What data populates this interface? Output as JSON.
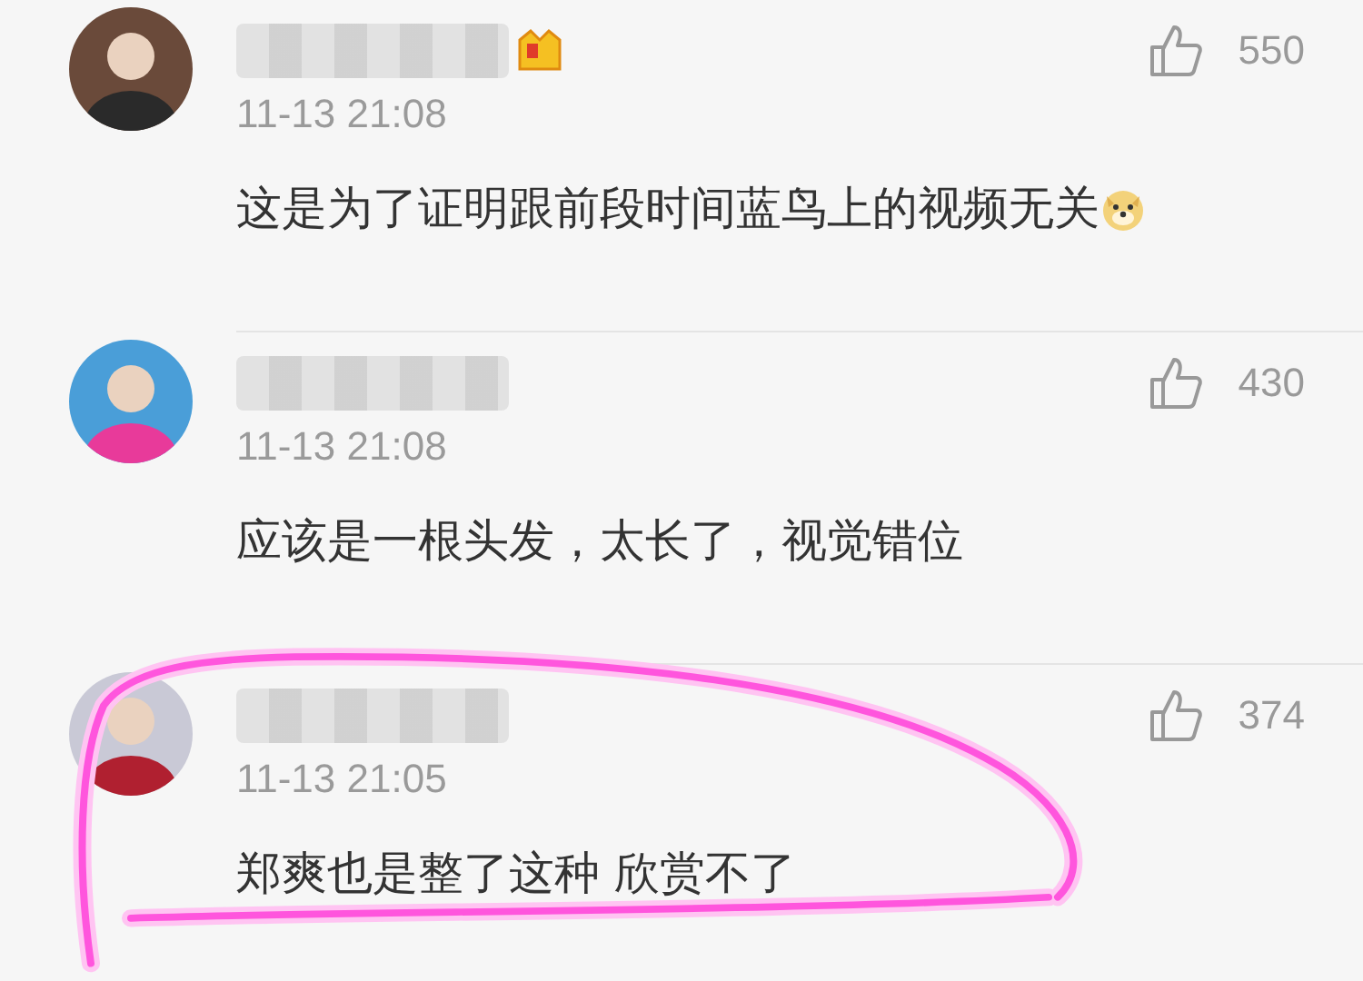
{
  "comments": [
    {
      "vip": true,
      "date": "11-13 21:08",
      "text": "这是为了证明跟前段时间蓝鸟上的视频无关",
      "doge_emoji": true,
      "likes": "550",
      "highlighted": false
    },
    {
      "vip": false,
      "date": "11-13 21:08",
      "text": "应该是一根头发，太长了，视觉错位",
      "doge_emoji": false,
      "likes": "430",
      "highlighted": false
    },
    {
      "vip": false,
      "date": "11-13 21:05",
      "text": "郑爽也是整了这种 欣赏不了",
      "doge_emoji": false,
      "likes": "374",
      "highlighted": true
    }
  ]
}
